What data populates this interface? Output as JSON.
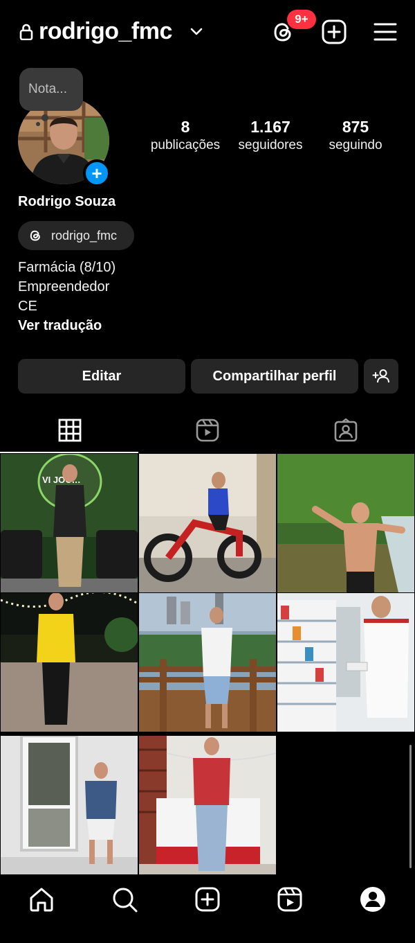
{
  "header": {
    "username": "rodrigo_fmc",
    "threads_badge": "9+",
    "icons": [
      "lock-icon",
      "chevron-down-icon",
      "threads-icon",
      "new-post-icon",
      "menu-icon"
    ]
  },
  "note": {
    "placeholder": "Nota..."
  },
  "stats": [
    {
      "value": "8",
      "label": "publicações"
    },
    {
      "value": "1.167",
      "label": "seguidores"
    },
    {
      "value": "875",
      "label": "seguindo"
    }
  ],
  "profile": {
    "name": "Rodrigo Souza",
    "threads_handle": "rodrigo_fmc",
    "bio": [
      "Farmácia (8/10)",
      "Empreendedor",
      "CE"
    ],
    "translate": "Ver tradução"
  },
  "actions": {
    "edit": "Editar",
    "share": "Compartilhar perfil"
  },
  "tabs": [
    "grid-icon",
    "reels-icon",
    "tagged-icon"
  ],
  "posts": [
    {
      "desc": "man standing in front of green neon wall"
    },
    {
      "desc": "man on dirt bike"
    },
    {
      "desc": "man shirtless at waterfall"
    },
    {
      "desc": "man in yellow shirt on patio"
    },
    {
      "desc": "man in white shirt on wooden deck"
    },
    {
      "desc": "man in pharmacy aisle"
    },
    {
      "desc": "man in denim shirt by window"
    },
    {
      "desc": "man in red shirt by christmas table"
    }
  ],
  "nav": [
    "home-icon",
    "search-icon",
    "create-icon",
    "reels-icon",
    "profile-icon"
  ],
  "colors": {
    "accent": "#0095f6",
    "badge": "#ff3040",
    "chip": "#262626",
    "background": "#000000"
  }
}
